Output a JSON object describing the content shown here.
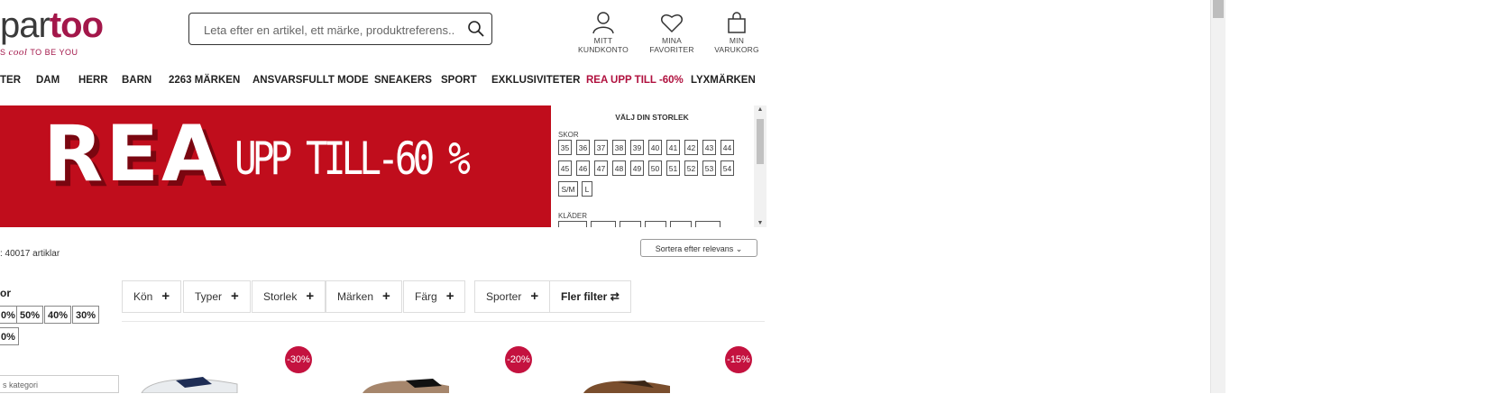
{
  "header": {
    "logo_part1": "par",
    "logo_part2": "too",
    "tagline_pre": "S",
    "tagline_cool": "cool",
    "tagline_post": "TO BE YOU",
    "search_placeholder": "Leta efter en artikel, ett märke, produktreferens..",
    "account_label": "MITT KUNDKONTO",
    "favorites_label": "MINA FAVORITER",
    "cart_label": "MIN VARUKORG"
  },
  "nav": {
    "items": [
      "TER",
      "DAM",
      "HERR",
      "BARN",
      "2263 MÄRKEN",
      "ANSVARSFULLT MODE",
      "SNEAKERS",
      "SPORT",
      "EXKLUSIVITETER",
      "REA UPP TILL -60%",
      "LYXMÄRKEN"
    ]
  },
  "banner": {
    "headline": "REA",
    "subline": "UPP TILL-60 %"
  },
  "size_panel": {
    "title": "VÄLJ DIN STORLEK",
    "shoes_label": "SKOR",
    "shoe_sizes": [
      "35",
      "36",
      "37",
      "38",
      "39",
      "40",
      "41",
      "42",
      "43",
      "44",
      "45",
      "46",
      "47",
      "48",
      "49",
      "50",
      "51",
      "52",
      "53",
      "54",
      "S/M",
      "L"
    ],
    "clothes_label": "KLÄDER"
  },
  "listing": {
    "count_text": ": 40017 artiklar",
    "sort_label": "Sortera efter relevans"
  },
  "discount_filter": {
    "title": "or",
    "options": [
      "0%",
      "50%",
      "40%",
      "30%",
      "0%"
    ],
    "category_search_placeholder": "s kategori"
  },
  "filters": {
    "items": [
      "Kön",
      "Typer",
      "Storlek",
      "Märken",
      "Färg",
      "Sporter"
    ],
    "more_label": "Fler filter"
  },
  "products": {
    "badges": [
      "-30%",
      "-20%",
      "-15%"
    ]
  },
  "colors": {
    "brand": "#a3174a",
    "sale_red": "#c00d1c",
    "badge": "#c4123f"
  }
}
